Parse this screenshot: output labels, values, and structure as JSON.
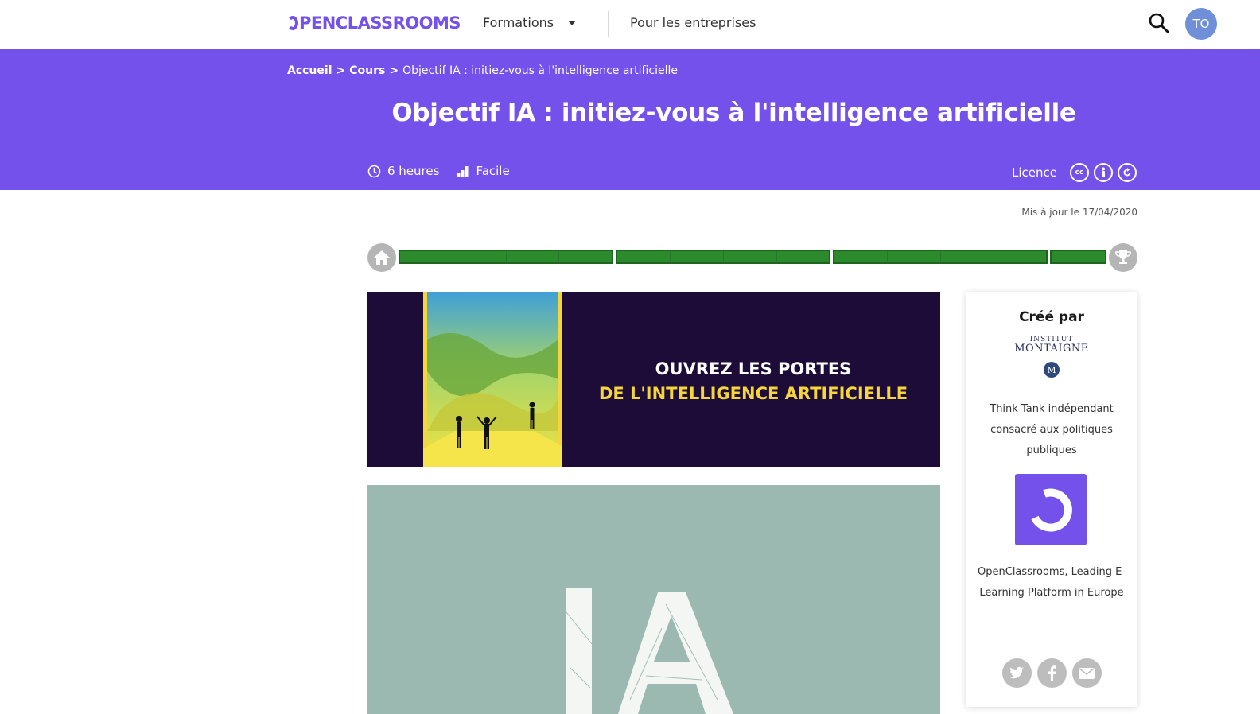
{
  "nav": {
    "logo": "OPENCLASSROOMS",
    "logo_rest": "PENCLASSROOMS",
    "formations_label": "Formations",
    "entreprises_label": "Pour les entreprises",
    "avatar_initials": "TO",
    "icons": [
      "search-icon",
      "chevron-down-icon"
    ]
  },
  "breadcrumb": {
    "home": "Accueil",
    "sep1": ">",
    "courses": "Cours",
    "sep2": ">",
    "current": "Objectif IA : initiez-vous à l'intelligence artificielle"
  },
  "course": {
    "title": "Objectif IA : initiez-vous à l'intelligence artificielle",
    "duration": "6 heures",
    "difficulty": "Facile",
    "licence_label": "Licence",
    "licence_icons": [
      "cc-icon",
      "by-icon",
      "sa-icon"
    ],
    "updated": "Mis à jour le 17/04/2020"
  },
  "progress": {
    "completion": 1.0,
    "parts": [
      4,
      4,
      4,
      1
    ],
    "color": "#2b8a2b"
  },
  "banner": {
    "line1": "OUVREZ LES PORTES",
    "line2": "DE L'INTELLIGENCE ARTIFICIELLE"
  },
  "ia_image": {
    "text": "IA"
  },
  "card": {
    "title": "Créé par",
    "partner1_small": "INSTITUT",
    "partner1_big": "MONTAIGNE",
    "partner1_badge": "M",
    "partner1_desc": "Think Tank indépendant consacré aux politiques publiques",
    "partner2_desc": "OpenClassrooms, Leading E-Learning Platform in Europe",
    "share_icons": [
      "twitter-icon",
      "facebook-icon",
      "mail-icon"
    ]
  },
  "colors": {
    "brand": "#7451eb",
    "progress": "#2b8a2b",
    "banner_bg": "#1c0c37",
    "banner_accent": "#f5d53a",
    "ia_bg": "#9bb8b1"
  }
}
